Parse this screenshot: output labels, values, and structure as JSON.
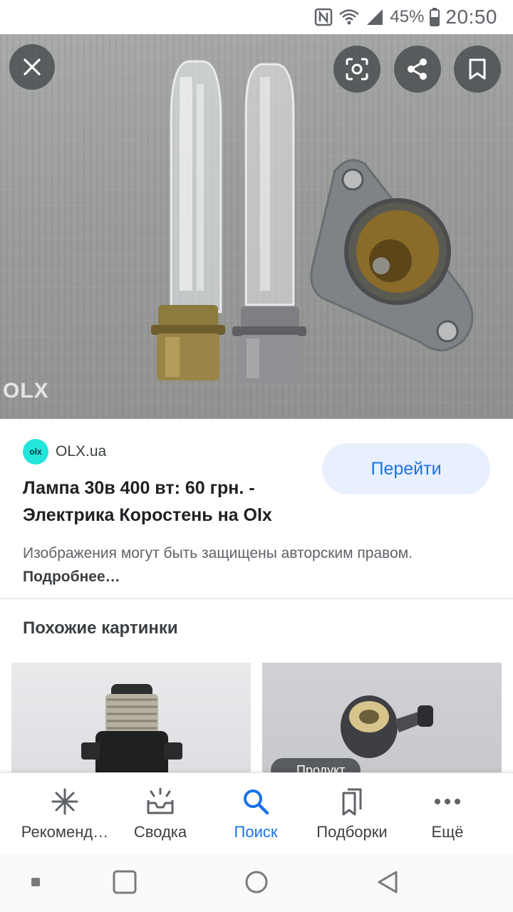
{
  "status_bar": {
    "battery": "45%",
    "time": "20:50"
  },
  "image_viewer": {
    "watermark": "OLX",
    "actions": {
      "close": "close-icon",
      "lens": "lens-icon",
      "share": "share-icon",
      "save": "bookmark-icon"
    }
  },
  "result": {
    "source_name": "OLX.ua",
    "source_logo_text": "olx",
    "visit_button": "Перейти",
    "title": "Лампа 30в 400 вт: 60 грн. - Электрика Коростень на Olx",
    "copyright_text": "Изображения могут быть защищены авторским правом.",
    "copyright_more": "Подробнее…"
  },
  "similar": {
    "heading": "Похожие картинки",
    "chip_label": "Продукт"
  },
  "bottom_nav": [
    {
      "label": "Рекоменд…",
      "icon": "asterisk-icon",
      "active": false
    },
    {
      "label": "Сводка",
      "icon": "inbox-updates-icon",
      "active": false
    },
    {
      "label": "Поиск",
      "icon": "search-icon",
      "active": true
    },
    {
      "label": "Подборки",
      "icon": "collections-icon",
      "active": false
    },
    {
      "label": "Ещё",
      "icon": "more-icon",
      "active": false
    }
  ],
  "colors": {
    "accent": "#1a73e8",
    "button_bg": "#e8f0fe",
    "olx_brand": "#23e5db"
  }
}
